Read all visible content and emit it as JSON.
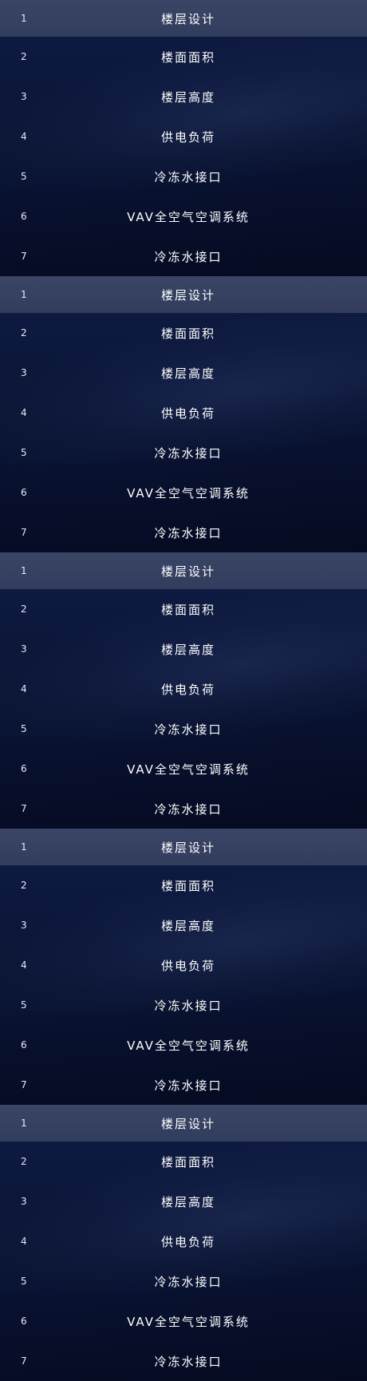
{
  "blocks": [
    {
      "rows": [
        {
          "num": "1",
          "label": "楼层设计"
        },
        {
          "num": "2",
          "label": "楼面面积"
        },
        {
          "num": "3",
          "label": "楼层高度"
        },
        {
          "num": "4",
          "label": "供电负荷"
        },
        {
          "num": "5",
          "label": "冷冻水接口"
        },
        {
          "num": "6",
          "label": "VAV全空气空调系统"
        },
        {
          "num": "7",
          "label": "冷冻水接口"
        }
      ]
    },
    {
      "rows": [
        {
          "num": "1",
          "label": "楼层设计"
        },
        {
          "num": "2",
          "label": "楼面面积"
        },
        {
          "num": "3",
          "label": "楼层高度"
        },
        {
          "num": "4",
          "label": "供电负荷"
        },
        {
          "num": "5",
          "label": "冷冻水接口"
        },
        {
          "num": "6",
          "label": "VAV全空气空调系统"
        },
        {
          "num": "7",
          "label": "冷冻水接口"
        }
      ]
    },
    {
      "rows": [
        {
          "num": "1",
          "label": "楼层设计"
        },
        {
          "num": "2",
          "label": "楼面面积"
        },
        {
          "num": "3",
          "label": "楼层高度"
        },
        {
          "num": "4",
          "label": "供电负荷"
        },
        {
          "num": "5",
          "label": "冷冻水接口"
        },
        {
          "num": "6",
          "label": "VAV全空气空调系统"
        },
        {
          "num": "7",
          "label": "冷冻水接口"
        }
      ]
    },
    {
      "rows": [
        {
          "num": "1",
          "label": "楼层设计"
        },
        {
          "num": "2",
          "label": "楼面面积"
        },
        {
          "num": "3",
          "label": "楼层高度"
        },
        {
          "num": "4",
          "label": "供电负荷"
        },
        {
          "num": "5",
          "label": "冷冻水接口"
        },
        {
          "num": "6",
          "label": "VAV全空气空调系统"
        },
        {
          "num": "7",
          "label": "冷冻水接口"
        }
      ]
    },
    {
      "rows": [
        {
          "num": "1",
          "label": "楼层设计"
        },
        {
          "num": "2",
          "label": "楼面面积"
        },
        {
          "num": "3",
          "label": "楼层高度"
        },
        {
          "num": "4",
          "label": "供电负荷"
        },
        {
          "num": "5",
          "label": "冷冻水接口"
        },
        {
          "num": "6",
          "label": "VAV全空气空调系统"
        },
        {
          "num": "7",
          "label": "冷冻水接口"
        }
      ]
    }
  ],
  "colors": {
    "background": "#0a1536",
    "header_row": "#353f60",
    "text": "#ffffff"
  }
}
